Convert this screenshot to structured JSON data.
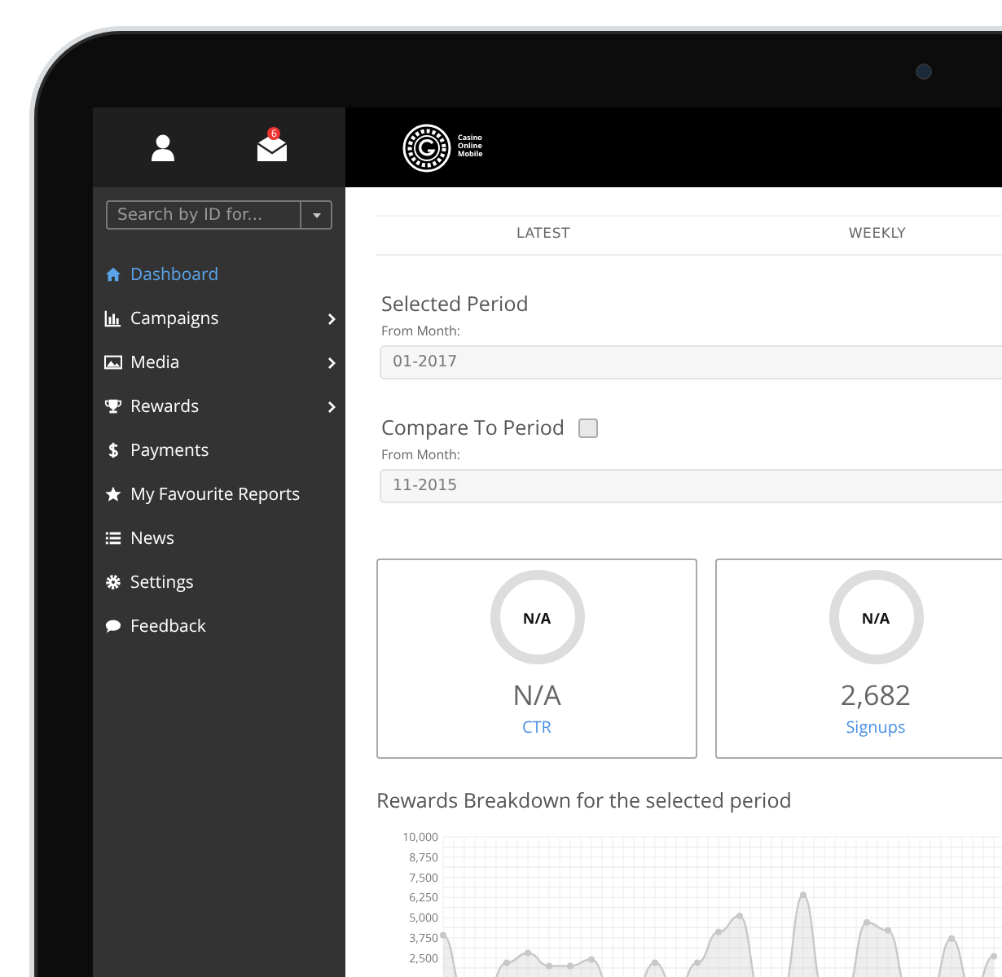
{
  "sidebar": {
    "header": {
      "notification_count": "6"
    },
    "search": {
      "placeholder": "Search by ID for..."
    },
    "items": [
      {
        "label": "Dashboard",
        "selected": true,
        "expandable": false
      },
      {
        "label": "Campaigns",
        "selected": false,
        "expandable": true
      },
      {
        "label": "Media",
        "selected": false,
        "expandable": true
      },
      {
        "label": "Rewards",
        "selected": false,
        "expandable": true
      },
      {
        "label": "Payments",
        "selected": false,
        "expandable": false
      },
      {
        "label": "My Favourite Reports",
        "selected": false,
        "expandable": false
      },
      {
        "label": "News",
        "selected": false,
        "expandable": false
      },
      {
        "label": "Settings",
        "selected": false,
        "expandable": false
      },
      {
        "label": "Feedback",
        "selected": false,
        "expandable": false
      }
    ]
  },
  "top_bar": {
    "logo_text": [
      "Casino",
      "Online",
      "Mobile"
    ]
  },
  "tabs": [
    {
      "label": "LATEST",
      "selected": false
    },
    {
      "label": "WEEKLY",
      "selected": false
    }
  ],
  "selected_period": {
    "title": "Selected Period",
    "field_label": "From Month:",
    "value": "01-2017"
  },
  "compare_period": {
    "title": "Compare To Period",
    "checked": false,
    "field_label": "From Month:",
    "value": "11-2015"
  },
  "stat_cards": [
    {
      "ring_label": "N/A",
      "value": "N/A",
      "label": "CTR"
    },
    {
      "ring_label": "N/A",
      "value": "2,682",
      "label": "Signups"
    }
  ],
  "rewards_chart": {
    "title": "Rewards Breakdown for the selected period",
    "chart_data": {
      "type": "area",
      "grid": true,
      "ylim": [
        0,
        10000
      ],
      "yticks": [
        {
          "value": 2500,
          "label": "2,500"
        },
        {
          "value": 3750,
          "label": "3,750"
        },
        {
          "value": 5000,
          "label": "5,000"
        },
        {
          "value": 6250,
          "label": "6,250"
        },
        {
          "value": 7500,
          "label": "7,500"
        },
        {
          "value": 8750,
          "label": "8,750"
        },
        {
          "value": 10000,
          "label": "10,000"
        }
      ],
      "series": [
        {
          "color": "#c8c8c8",
          "values": [
            3900,
            300,
            300,
            2200,
            2800,
            2000,
            2000,
            2400,
            300,
            300,
            2200,
            300,
            2200,
            4100,
            5100,
            300,
            300,
            6400,
            300,
            300,
            4700,
            4200,
            300,
            300,
            3700,
            300,
            2600
          ]
        }
      ]
    }
  }
}
